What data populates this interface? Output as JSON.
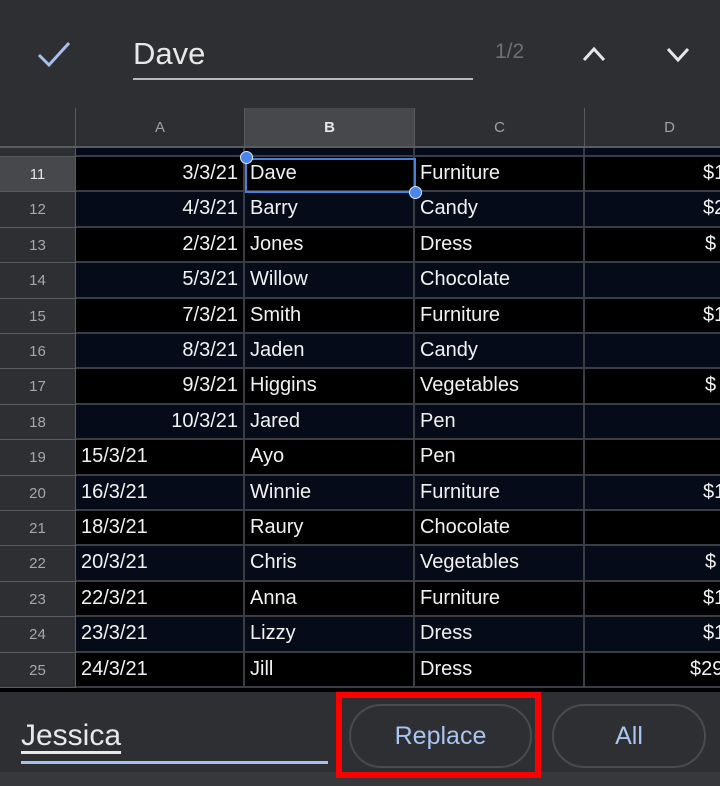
{
  "find_bar": {
    "confirm_icon": "check-icon",
    "search_value": "Dave",
    "match_counter": "1/2",
    "prev_icon": "chevron-up-icon",
    "next_icon": "chevron-down-icon"
  },
  "sheet": {
    "columns": [
      "A",
      "B",
      "C",
      "D"
    ],
    "selected_column": "B",
    "selected_row": 11,
    "rows": [
      {
        "num": "11",
        "a": "3/3/21",
        "b": "Dave",
        "c": "Furniture",
        "d": "$1",
        "a_align": "right"
      },
      {
        "num": "12",
        "a": "4/3/21",
        "b": "Barry",
        "c": "Candy",
        "d": "$2",
        "a_align": "right"
      },
      {
        "num": "13",
        "a": "2/3/21",
        "b": "Jones",
        "c": "Dress",
        "d": "$",
        "a_align": "right"
      },
      {
        "num": "14",
        "a": "5/3/21",
        "b": "Willow",
        "c": "Chocolate",
        "d": "",
        "a_align": "right"
      },
      {
        "num": "15",
        "a": "7/3/21",
        "b": "Smith",
        "c": "Furniture",
        "d": "$1",
        "a_align": "right"
      },
      {
        "num": "16",
        "a": "8/3/21",
        "b": "Jaden",
        "c": "Candy",
        "d": "",
        "a_align": "right"
      },
      {
        "num": "17",
        "a": "9/3/21",
        "b": "Higgins",
        "c": "Vegetables",
        "d": "$",
        "a_align": "right"
      },
      {
        "num": "18",
        "a": "10/3/21",
        "b": "Jared",
        "c": "Pen",
        "d": "",
        "a_align": "right"
      },
      {
        "num": "19",
        "a": "15/3/21",
        "b": "Ayo",
        "c": "Pen",
        "d": "",
        "a_align": "left"
      },
      {
        "num": "20",
        "a": "16/3/21",
        "b": "Winnie",
        "c": "Furniture",
        "d": "$1",
        "a_align": "left"
      },
      {
        "num": "21",
        "a": "18/3/21",
        "b": "Raury",
        "c": "Chocolate",
        "d": "",
        "a_align": "left"
      },
      {
        "num": "22",
        "a": "20/3/21",
        "b": "Chris",
        "c": "Vegetables",
        "d": "$",
        "a_align": "left"
      },
      {
        "num": "23",
        "a": "22/3/21",
        "b": "Anna",
        "c": "Furniture",
        "d": "$1",
        "a_align": "left"
      },
      {
        "num": "24",
        "a": "23/3/21",
        "b": "Lizzy",
        "c": "Dress",
        "d": "$1",
        "a_align": "left"
      },
      {
        "num": "25",
        "a": "24/3/21",
        "b": "Jill",
        "c": "Dress",
        "d": "$29",
        "a_align": "left"
      }
    ]
  },
  "replace_bar": {
    "replace_value": "Jessica",
    "replace_label": "Replace",
    "all_label": "All"
  },
  "colors": {
    "accent": "#4a86e8",
    "row_odd": "#000000",
    "row_even": "#050b18",
    "highlight": "#ff0000"
  }
}
